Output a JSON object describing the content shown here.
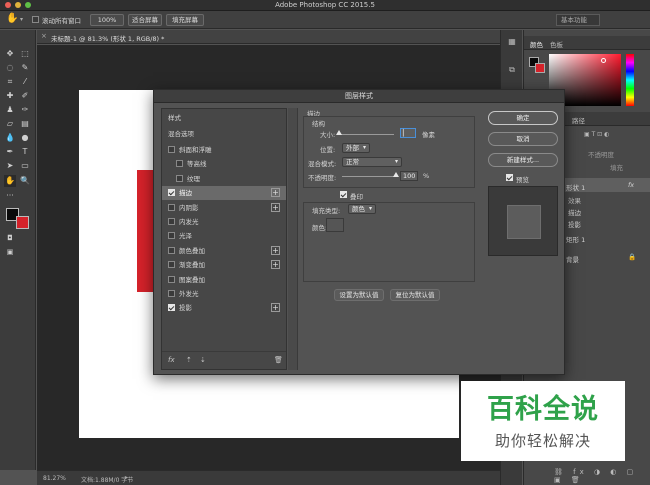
{
  "app": {
    "title": "Adobe Photoshop CC 2015.5"
  },
  "options_bar": {
    "scroll_all_label": "滚动所有窗口",
    "zoom_value": "100%",
    "fit_screen_label": "适合屏幕",
    "fill_screen_label": "填充屏幕",
    "workspace_label": "基本功能"
  },
  "document": {
    "tab_title": "未标题-1 @ 81.3% (形状 1, RGB/8) *",
    "zoom_status": "81.27%",
    "doc_info": "文档:1.88M/0 字节"
  },
  "colors": {
    "foreground": "#0a0a0a",
    "background": "#ffffff",
    "swatch_red": "#d5222a",
    "canvas": "#ffffff",
    "shape": "#d5222a"
  },
  "panels": {
    "color_tabs": [
      "颜色",
      "色板"
    ],
    "layers_tabs": [
      "图层",
      "路径"
    ],
    "opacity_label": "不透明度",
    "fill_label": "填充",
    "layers": [
      {
        "name": "形状 1",
        "fx": "fx"
      },
      {
        "name": "效果"
      },
      {
        "name": "描边"
      },
      {
        "name": "投影"
      },
      {
        "name": "矩形 1"
      },
      {
        "name": "背景"
      }
    ]
  },
  "dialog": {
    "title": "图层样式",
    "styles_header": "样式",
    "blend_options": "混合选项",
    "items": [
      {
        "label": "斜面和浮雕",
        "checked": false,
        "plus": false,
        "indent": false
      },
      {
        "label": "等高线",
        "checked": false,
        "plus": false,
        "indent": true
      },
      {
        "label": "纹理",
        "checked": false,
        "plus": false,
        "indent": true
      },
      {
        "label": "描边",
        "checked": true,
        "plus": true,
        "indent": false,
        "selected": true
      },
      {
        "label": "内阴影",
        "checked": false,
        "plus": true,
        "indent": false
      },
      {
        "label": "内发光",
        "checked": false,
        "plus": false,
        "indent": false
      },
      {
        "label": "光泽",
        "checked": false,
        "plus": false,
        "indent": false
      },
      {
        "label": "颜色叠加",
        "checked": false,
        "plus": true,
        "indent": false
      },
      {
        "label": "渐变叠加",
        "checked": false,
        "plus": true,
        "indent": false
      },
      {
        "label": "图案叠加",
        "checked": false,
        "plus": false,
        "indent": false
      },
      {
        "label": "外发光",
        "checked": false,
        "plus": false,
        "indent": false
      },
      {
        "label": "投影",
        "checked": true,
        "plus": true,
        "indent": false
      }
    ],
    "footer_fx": "fx",
    "stroke": {
      "section_title": "描边",
      "structure_title": "结构",
      "size_label": "大小:",
      "size_unit": "像素",
      "position_label": "位置:",
      "position_value": "外部",
      "blend_mode_label": "混合模式:",
      "blend_mode_value": "正常",
      "opacity_label": "不透明度:",
      "opacity_value": "100",
      "opacity_unit": "%",
      "opacity_fraction": 1.0,
      "emboss_label": "叠印",
      "emboss_checked": true,
      "fill_type_label": "填充类型:",
      "fill_type_value": "颜色",
      "color_label": "颜色:",
      "stroke_color": "#555555"
    },
    "buttons": {
      "set_default": "设置为默认值",
      "reset_default": "复位为默认值",
      "ok": "确定",
      "cancel": "取消",
      "new_style": "新建样式...",
      "preview_label": "预览"
    }
  },
  "watermark": {
    "title": "百科全说",
    "subtitle": "助你轻松解决"
  }
}
